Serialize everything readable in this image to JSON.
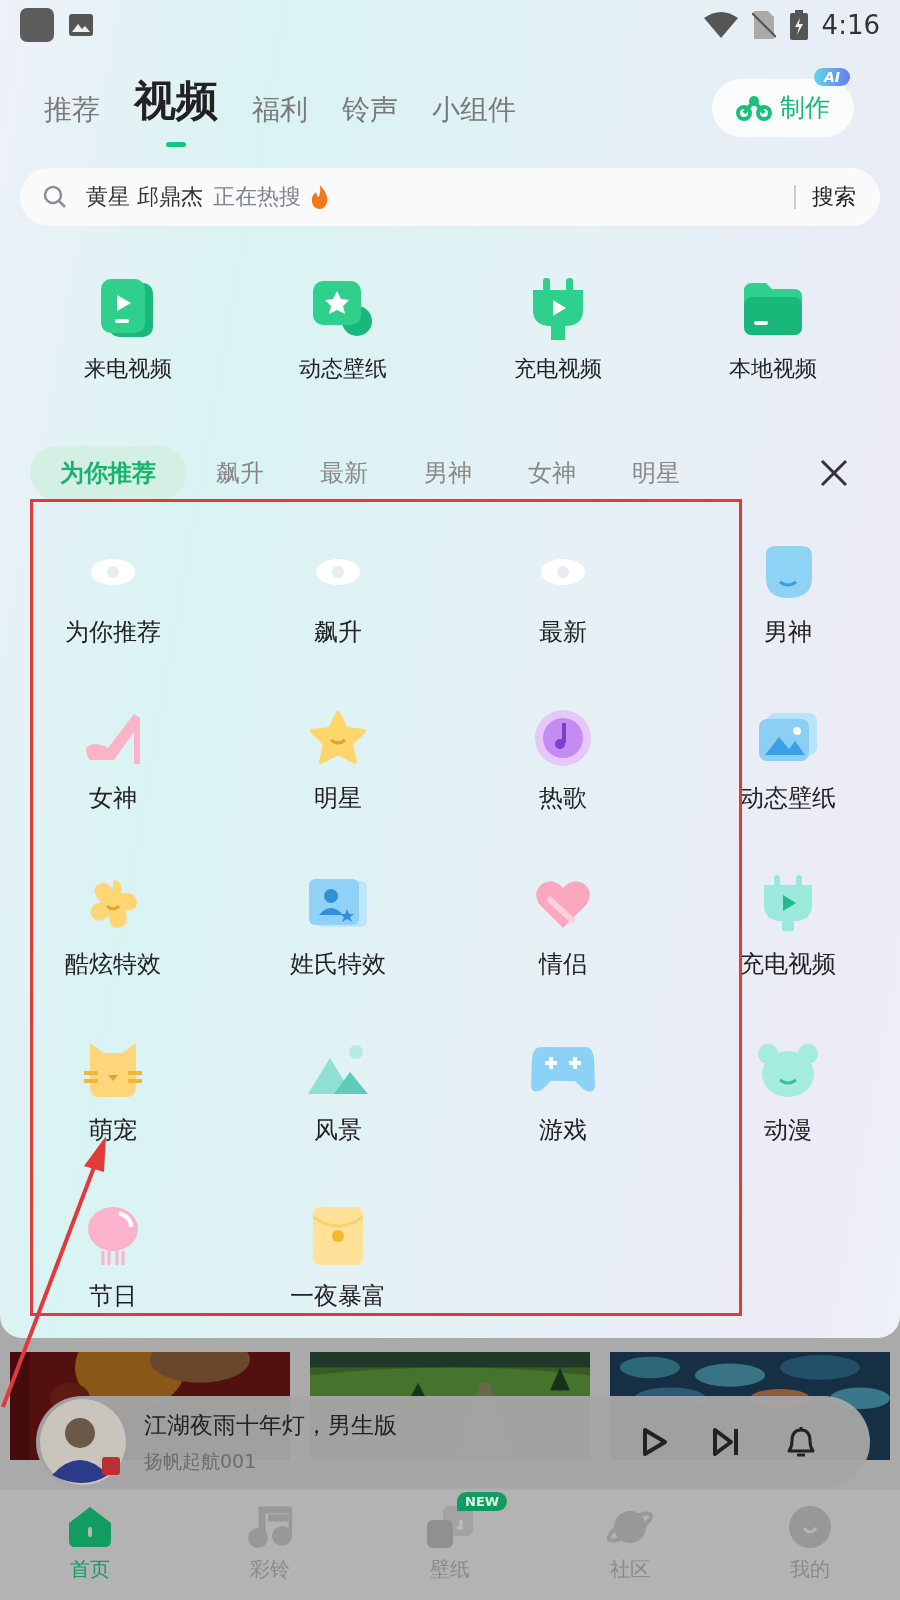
{
  "status_bar": {
    "time": "4:16"
  },
  "top_tabs": [
    {
      "label": "推荐",
      "selected": false
    },
    {
      "label": "视频",
      "selected": true
    },
    {
      "label": "福利",
      "selected": false
    },
    {
      "label": "铃声",
      "selected": false
    },
    {
      "label": "小组件",
      "selected": false
    }
  ],
  "make_button": {
    "label": "制作",
    "badge": "AI"
  },
  "search": {
    "query": "黄星 邱鼎杰",
    "trend": "正在热搜",
    "button": "搜索"
  },
  "shortcuts": [
    {
      "label": "来电视频",
      "kind": "phone"
    },
    {
      "label": "动态壁纸",
      "kind": "star"
    },
    {
      "label": "充电视频",
      "kind": "plug"
    },
    {
      "label": "本地视频",
      "kind": "folder"
    }
  ],
  "category_chips": [
    {
      "label": "为你推荐",
      "selected": true
    },
    {
      "label": "飙升",
      "selected": false
    },
    {
      "label": "最新",
      "selected": false
    },
    {
      "label": "男神",
      "selected": false
    },
    {
      "label": "女神",
      "selected": false
    },
    {
      "label": "明星",
      "selected": false
    }
  ],
  "category_grid": [
    {
      "label": "为你推荐",
      "kind": "eye"
    },
    {
      "label": "飙升",
      "kind": "eye"
    },
    {
      "label": "最新",
      "kind": "eye"
    },
    {
      "label": "男神",
      "kind": "face"
    },
    {
      "label": "女神",
      "kind": "heel"
    },
    {
      "label": "明星",
      "kind": "star"
    },
    {
      "label": "热歌",
      "kind": "disc"
    },
    {
      "label": "动态壁纸",
      "kind": "gallery"
    },
    {
      "label": "酷炫特效",
      "kind": "flower"
    },
    {
      "label": "姓氏特效",
      "kind": "card"
    },
    {
      "label": "情侣",
      "kind": "heart"
    },
    {
      "label": "充电视频",
      "kind": "plug"
    },
    {
      "label": "萌宠",
      "kind": "cat"
    },
    {
      "label": "风景",
      "kind": "mountain"
    },
    {
      "label": "游戏",
      "kind": "gamepad"
    },
    {
      "label": "动漫",
      "kind": "bear"
    },
    {
      "label": "节日",
      "kind": "lantern"
    },
    {
      "label": "一夜暴富",
      "kind": "envelope"
    }
  ],
  "player": {
    "title": "江湖夜雨十年灯，男生版",
    "artist": "扬帆起航001"
  },
  "bottom_nav": [
    {
      "label": "首页",
      "selected": true,
      "kind": "home"
    },
    {
      "label": "彩铃",
      "selected": false,
      "kind": "note"
    },
    {
      "label": "壁纸",
      "selected": false,
      "kind": "wallpaper",
      "badge": "NEW"
    },
    {
      "label": "社区",
      "selected": false,
      "kind": "planet"
    },
    {
      "label": "我的",
      "selected": false,
      "kind": "smile"
    }
  ]
}
